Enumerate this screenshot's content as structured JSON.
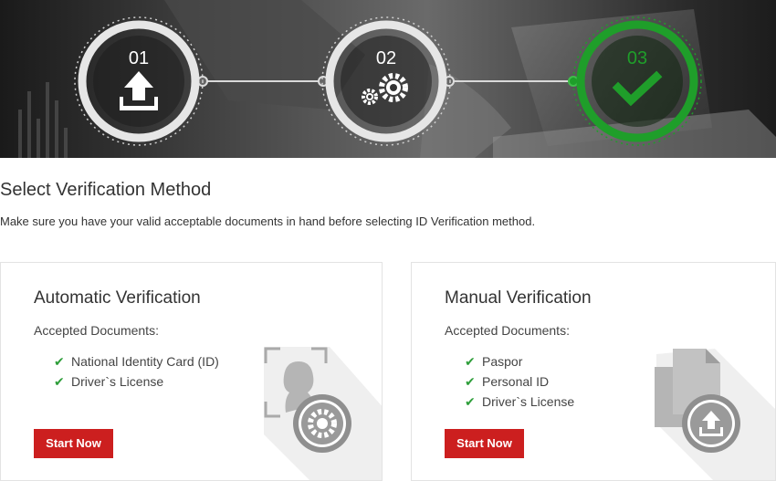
{
  "steps": [
    {
      "number": "01",
      "icon": "upload-icon",
      "color": "#ffffff"
    },
    {
      "number": "02",
      "icon": "gears-icon",
      "color": "#ffffff"
    },
    {
      "number": "03",
      "icon": "checkmark-icon",
      "color": "#1f9e2a"
    }
  ],
  "heading": {
    "title": "Select Verification Method",
    "subtitle": "Make sure you have your valid acceptable documents in hand before selecting ID Verification method."
  },
  "cards": [
    {
      "title": "Automatic Verification",
      "accepted_label": "Accepted Documents:",
      "documents": [
        "National Identity Card (ID)",
        "Driver`s License"
      ],
      "button": "Start Now",
      "icon": "id-face-gear-icon"
    },
    {
      "title": "Manual Verification",
      "accepted_label": "Accepted Documents:",
      "documents": [
        "Paspor",
        "Personal ID",
        "Driver`s License"
      ],
      "button": "Start Now",
      "icon": "documents-upload-icon"
    }
  ],
  "colors": {
    "accent_red": "#cc1f1f",
    "check_green": "#2e9e3a",
    "step_done_green": "#1f9e2a"
  }
}
